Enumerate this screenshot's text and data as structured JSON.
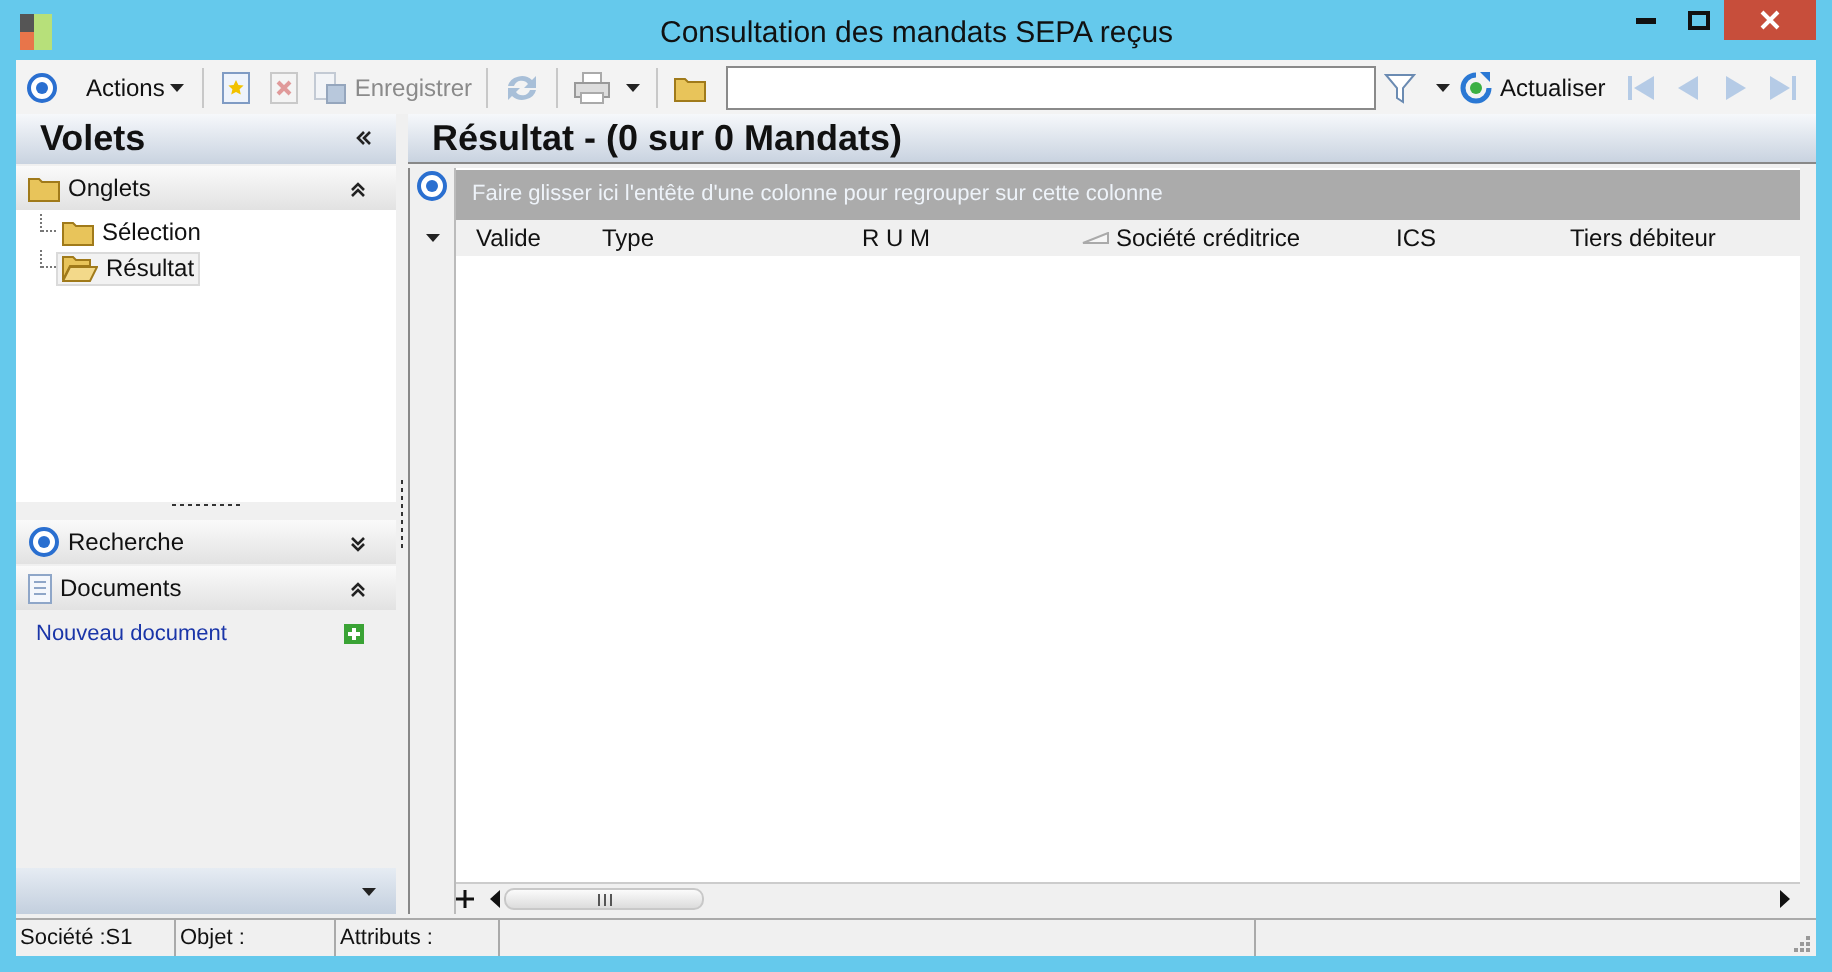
{
  "window": {
    "title": "Consultation des mandats SEPA reçus"
  },
  "toolbar": {
    "actions_menu": {
      "label": "Actions"
    },
    "save_button": {
      "label": "Enregistrer",
      "disabled": true
    },
    "refresh_button": {
      "label": "Actualiser"
    },
    "navigation_disabled": true
  },
  "side_panel": {
    "title": "Volets",
    "sections": [
      {
        "kind": "tree",
        "label": "Onglets",
        "expanded": true,
        "children": [
          {
            "label": "Sélection",
            "selected": false
          },
          {
            "label": "Résultat",
            "selected": true
          }
        ]
      },
      {
        "kind": "search",
        "label": "Recherche",
        "expanded": false
      },
      {
        "kind": "documents",
        "label": "Documents",
        "expanded": true,
        "links": [
          "Nouveau document"
        ]
      }
    ]
  },
  "result": {
    "title": "Résultat - (0 sur 0 Mandats)",
    "group_hint": "Faire glisser ici l'entête d'une colonne pour regrouper sur cette colonne",
    "columns": [
      {
        "label": "Valide",
        "sorted": false
      },
      {
        "label": "Type",
        "sorted": false
      },
      {
        "label": "R U M",
        "sorted": false
      },
      {
        "label": "Société créditrice",
        "sorted": true
      },
      {
        "label": "ICS",
        "sorted": false
      },
      {
        "label": "Tiers débiteur",
        "sorted": false
      }
    ]
  },
  "status_bar": [
    "Société :S1",
    "Objet :",
    "Attributs :"
  ]
}
